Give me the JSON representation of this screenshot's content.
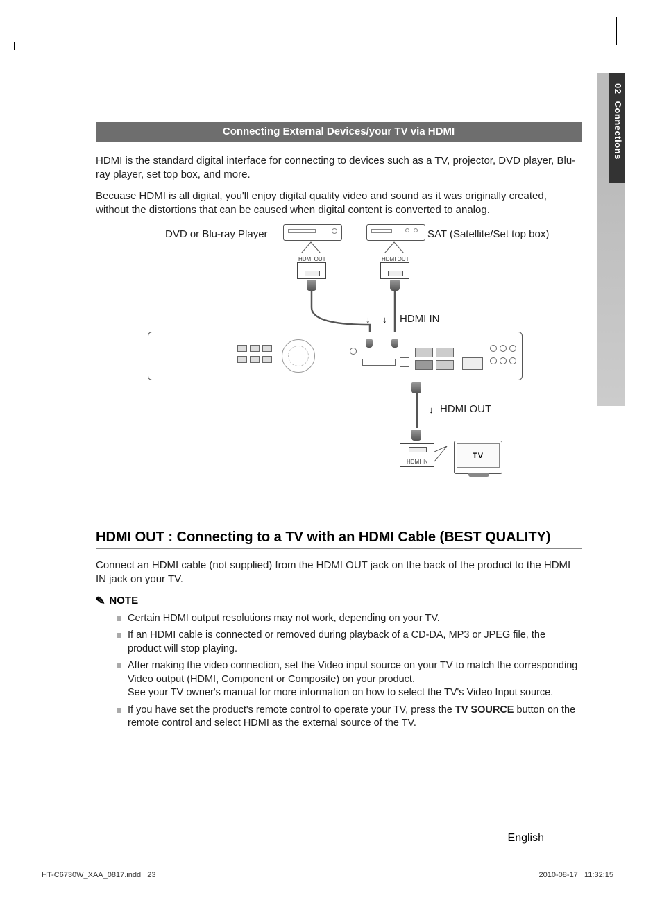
{
  "sideTab": {
    "number": "02",
    "label": "Connections"
  },
  "banner": "Connecting External Devices/your TV via HDMI",
  "intro1": "HDMI is the standard digital interface for connecting to devices such as a TV, projector, DVD player, Blu-ray player, set top box, and more.",
  "intro2": "Becuase HDMI is all digital, you'll enjoy digital quality video and sound as it was originally created, without the distortions that can be caused when digital content is converted to analog.",
  "diagram": {
    "dvdLabel": "DVD or Blu-ray Player",
    "satLabel": "SAT (Satellite/Set top box)",
    "hdmiOutSmall1": "HDMI OUT",
    "hdmiOutSmall2": "HDMI OUT",
    "hdmiIn": "HDMI IN",
    "hdmiOut": "HDMI OUT",
    "hdmiInSmall": "HDMI  IN",
    "tv": "TV"
  },
  "section": {
    "titleBold": "HDMI OUT : ",
    "titleRest": "Connecting to a TV with an HDMI Cable (BEST QUALITY)",
    "desc": "Connect an HDMI cable (not supplied) from the HDMI OUT jack on the back of the product to the HDMI IN jack on your TV.",
    "noteLabel": "NOTE",
    "notes": {
      "n1": "Certain HDMI output resolutions may not work, depending on your TV.",
      "n2": "If an HDMI cable is connected or removed during playback of a CD-DA, MP3 or JPEG file, the product will stop playing.",
      "n3a": "After making the video connection, set the Video input source on your TV to match the corresponding Video output (HDMI, Component or Composite) on your product.",
      "n3b": "See your TV owner's manual for more information on how to select the TV's Video Input source.",
      "n4a": "If you have set the product's remote control to operate your TV, press the ",
      "n4bold": "TV SOURCE",
      "n4b": " button on the remote control and select HDMI as the external source of the TV."
    }
  },
  "footer": {
    "lang": "English",
    "leftFile": "HT-C6730W_XAA_0817.indd",
    "leftPage": "23",
    "date": "2010-08-17",
    "time": "11:32:15"
  }
}
